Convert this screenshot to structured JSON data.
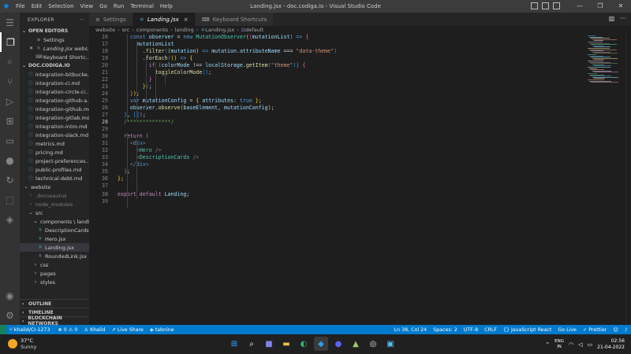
{
  "window": {
    "title": "Landing.jsx - doc.codiga.io - Visual Studio Code",
    "menu": [
      "File",
      "Edit",
      "Selection",
      "View",
      "Go",
      "Run",
      "Terminal",
      "Help"
    ]
  },
  "sidebar": {
    "header": "EXPLORER",
    "open_editors_label": "OPEN EDITORS",
    "open_editors": [
      {
        "name": "Settings",
        "icon": "gear-icon"
      },
      {
        "name": "Landing.jsx  webs...",
        "icon": "react-icon",
        "active": true
      },
      {
        "name": "Keyboard Shortc...",
        "icon": "keyboard-icon"
      }
    ],
    "folder_label": "DOC.CODIGA.IO",
    "tree": [
      {
        "name": "integration-bitbucke...",
        "type": "md",
        "depth": 1
      },
      {
        "name": "integration-ci.md",
        "type": "md",
        "depth": 1
      },
      {
        "name": "integration-circle-ci...",
        "type": "md",
        "depth": 1
      },
      {
        "name": "integration-github-a...",
        "type": "md",
        "depth": 1
      },
      {
        "name": "integration-github.md",
        "type": "md",
        "depth": 1
      },
      {
        "name": "integration-gitlab.md",
        "type": "md",
        "depth": 1
      },
      {
        "name": "integration-intro.md",
        "type": "md",
        "depth": 1
      },
      {
        "name": "integration-slack.md",
        "type": "md",
        "depth": 1
      },
      {
        "name": "metrics.md",
        "type": "md",
        "depth": 1
      },
      {
        "name": "pricing.md",
        "type": "md",
        "depth": 1
      },
      {
        "name": "project-preferences...",
        "type": "md",
        "depth": 1
      },
      {
        "name": "public-profiles.md",
        "type": "md",
        "depth": 1
      },
      {
        "name": "technical-debt.md",
        "type": "md",
        "depth": 1
      },
      {
        "name": "website",
        "type": "folder-open",
        "depth": 0
      },
      {
        "name": ".docusaurus",
        "type": "folder",
        "depth": 1,
        "dim": true
      },
      {
        "name": "node_modules",
        "type": "folder",
        "depth": 1,
        "dim": true
      },
      {
        "name": "src",
        "type": "folder-open",
        "depth": 1
      },
      {
        "name": "components \\ landi...",
        "type": "folder-open",
        "depth": 2
      },
      {
        "name": "DescriptionCards....",
        "type": "jsx",
        "depth": 3
      },
      {
        "name": "Hero.jsx",
        "type": "jsx",
        "depth": 3
      },
      {
        "name": "Landing.jsx",
        "type": "jsx",
        "depth": 3,
        "selected": true
      },
      {
        "name": "RoundedLink.jsx",
        "type": "jsx",
        "depth": 3
      },
      {
        "name": "css",
        "type": "folder",
        "depth": 2
      },
      {
        "name": "pages",
        "type": "folder",
        "depth": 2
      },
      {
        "name": "styles",
        "type": "folder",
        "depth": 2
      }
    ],
    "bottom_sections": [
      "OUTLINE",
      "TIMELINE",
      "BLOCKCHAIN NETWORKS"
    ]
  },
  "tabs": [
    {
      "label": "Settings",
      "icon": "gear-icon"
    },
    {
      "label": "Landing.jsx",
      "icon": "react-icon",
      "active": true,
      "close": "×"
    },
    {
      "label": "Keyboard Shortcuts",
      "icon": "keyboard-icon"
    }
  ],
  "breadcrumb": [
    "website",
    "src",
    "components",
    "landing",
    "Landing.jsx",
    "default"
  ],
  "editor": {
    "current_line": 28,
    "lines": [
      {
        "n": "16",
        "seg": [
          [
            "pl",
            "    "
          ],
          [
            "kw",
            "const "
          ],
          [
            "vr",
            "observer"
          ],
          [
            "pl",
            " = "
          ],
          [
            "kw",
            "new "
          ],
          [
            "cp",
            "MutationObserver"
          ],
          [
            "br1",
            "("
          ],
          [
            "br2",
            "("
          ],
          [
            "vr",
            "mutationList"
          ],
          [
            "br2",
            ")"
          ],
          [
            "pl",
            " "
          ],
          [
            "kw",
            "=>"
          ],
          [
            "pl",
            " "
          ],
          [
            "br2",
            "{"
          ]
        ]
      },
      {
        "n": "17",
        "seg": [
          [
            "pl",
            "      "
          ],
          [
            "vr",
            "mutationList"
          ]
        ]
      },
      {
        "n": "18",
        "seg": [
          [
            "pl",
            "        ."
          ],
          [
            "fn",
            "filter"
          ],
          [
            "br3",
            "("
          ],
          [
            "br1",
            "("
          ],
          [
            "vr",
            "mutation"
          ],
          [
            "br1",
            ")"
          ],
          [
            "pl",
            " "
          ],
          [
            "kw",
            "=>"
          ],
          [
            "pl",
            " "
          ],
          [
            "vr",
            "mutation"
          ],
          [
            "pl",
            "."
          ],
          [
            "vr",
            "attributeName"
          ],
          [
            "pl",
            " === "
          ],
          [
            "str",
            "\"data-theme\""
          ],
          [
            "br3",
            ")"
          ]
        ]
      },
      {
        "n": "19",
        "seg": [
          [
            "pl",
            "        ."
          ],
          [
            "fn",
            "forEach"
          ],
          [
            "br3",
            "("
          ],
          [
            "br1",
            "("
          ],
          [
            "br1",
            ")"
          ],
          [
            "pl",
            " "
          ],
          [
            "kw",
            "=>"
          ],
          [
            "pl",
            " "
          ],
          [
            "br1",
            "{"
          ]
        ]
      },
      {
        "n": "20",
        "seg": [
          [
            "pl",
            "          "
          ],
          [
            "kc",
            "if "
          ],
          [
            "br2",
            "("
          ],
          [
            "vr",
            "colorMode"
          ],
          [
            "pl",
            " !== "
          ],
          [
            "vr",
            "localStorage"
          ],
          [
            "pl",
            "."
          ],
          [
            "fn",
            "getItem"
          ],
          [
            "br3",
            "("
          ],
          [
            "str",
            "\"theme\""
          ],
          [
            "br3",
            ")"
          ],
          [
            "br2",
            ")"
          ],
          [
            "pl",
            " "
          ],
          [
            "br2",
            "{"
          ]
        ]
      },
      {
        "n": "21",
        "seg": [
          [
            "pl",
            "            "
          ],
          [
            "fn",
            "toggleColorMode"
          ],
          [
            "br3",
            "("
          ],
          [
            "br3",
            ")"
          ],
          [
            "pl",
            ";"
          ]
        ]
      },
      {
        "n": "22",
        "seg": [
          [
            "pl",
            "          "
          ],
          [
            "br2",
            "}"
          ]
        ]
      },
      {
        "n": "23",
        "seg": [
          [
            "pl",
            "        "
          ],
          [
            "br1",
            "}"
          ],
          [
            "br3",
            ")"
          ],
          [
            "pl",
            ";"
          ]
        ]
      },
      {
        "n": "24",
        "seg": [
          [
            "pl",
            "    "
          ],
          [
            "br2",
            "}"
          ],
          [
            "br1",
            ")"
          ],
          [
            "pl",
            ";"
          ]
        ]
      },
      {
        "n": "25",
        "seg": [
          [
            "pl",
            "    "
          ],
          [
            "kw",
            "var "
          ],
          [
            "vr",
            "mutationConfig"
          ],
          [
            "pl",
            " = "
          ],
          [
            "br1",
            "{"
          ],
          [
            "pl",
            " "
          ],
          [
            "vr",
            "attributes"
          ],
          [
            "pl",
            ": "
          ],
          [
            "kw",
            "true"
          ],
          [
            "pl",
            " "
          ],
          [
            "br1",
            "}"
          ],
          [
            "pl",
            ";"
          ]
        ]
      },
      {
        "n": "26",
        "seg": [
          [
            "pl",
            "    "
          ],
          [
            "vr",
            "observer"
          ],
          [
            "pl",
            "."
          ],
          [
            "fn",
            "observe"
          ],
          [
            "br1",
            "("
          ],
          [
            "vr",
            "baseElement"
          ],
          [
            "pl",
            ", "
          ],
          [
            "vr",
            "mutationConfig"
          ],
          [
            "br1",
            ")"
          ],
          [
            "pl",
            ";"
          ]
        ]
      },
      {
        "n": "27",
        "seg": [
          [
            "pl",
            "  "
          ],
          [
            "br3",
            "}"
          ],
          [
            "pl",
            ", "
          ],
          [
            "br3",
            "[]"
          ],
          [
            "br2",
            ")"
          ],
          [
            "pl",
            ";"
          ]
        ]
      },
      {
        "n": "28",
        "seg": [
          [
            "pl",
            "  "
          ],
          [
            "cm",
            "/**************/"
          ]
        ]
      },
      {
        "n": "29",
        "seg": [
          [
            "pl",
            "  "
          ]
        ]
      },
      {
        "n": "30",
        "seg": [
          [
            "pl",
            "  "
          ],
          [
            "kc",
            "return "
          ],
          [
            "br2",
            "("
          ]
        ]
      },
      {
        "n": "31",
        "seg": [
          [
            "pl",
            "    "
          ],
          [
            "tg",
            "<"
          ],
          [
            "tn",
            "div"
          ],
          [
            "tg",
            ">"
          ]
        ]
      },
      {
        "n": "32",
        "seg": [
          [
            "pl",
            "      "
          ],
          [
            "tg",
            "<"
          ],
          [
            "cp",
            "Hero"
          ],
          [
            "pl",
            " "
          ],
          [
            "tg",
            "/>"
          ]
        ]
      },
      {
        "n": "33",
        "seg": [
          [
            "pl",
            "      "
          ],
          [
            "tg",
            "<"
          ],
          [
            "cp",
            "DescriptionCards"
          ],
          [
            "pl",
            " "
          ],
          [
            "tg",
            "/>"
          ]
        ]
      },
      {
        "n": "34",
        "seg": [
          [
            "pl",
            "    "
          ],
          [
            "tg",
            "</"
          ],
          [
            "tn",
            "div"
          ],
          [
            "tg",
            ">"
          ]
        ]
      },
      {
        "n": "35",
        "seg": [
          [
            "pl",
            "  "
          ],
          [
            "br2",
            ")"
          ],
          [
            "pl",
            ";"
          ]
        ]
      },
      {
        "n": "36",
        "seg": [
          [
            "br1",
            "}"
          ],
          [
            "pl",
            ";"
          ]
        ]
      },
      {
        "n": "37",
        "seg": [
          [
            "pl",
            ""
          ]
        ]
      },
      {
        "n": "38",
        "seg": [
          [
            "kc",
            "export "
          ],
          [
            "kc",
            "default "
          ],
          [
            "vr",
            "Landing"
          ],
          [
            "pl",
            ";"
          ]
        ]
      },
      {
        "n": "39",
        "seg": [
          [
            "pl",
            ""
          ]
        ]
      }
    ]
  },
  "statusbar": {
    "left": [
      {
        "text": "khalid/CI-1273",
        "icon": "branch-icon"
      },
      {
        "text": "⊗ 0 ⚠ 0",
        "icon": "sync-icon"
      },
      {
        "text": "Khalid",
        "icon": "person-icon"
      },
      {
        "text": "Live Share",
        "icon": "share-icon"
      },
      {
        "text": "tabnine",
        "icon": "tabnine-icon"
      }
    ],
    "right": [
      {
        "text": "Ln 38, Col 24"
      },
      {
        "text": "Spaces: 2"
      },
      {
        "text": "UTF-8"
      },
      {
        "text": "CRLF"
      },
      {
        "text": "{} JavaScript React"
      },
      {
        "text": "Go Live"
      },
      {
        "text": "✓ Prettier"
      }
    ]
  },
  "taskbar": {
    "weather_temp": "37°C",
    "weather_desc": "Sunny",
    "lang_top": "ENG",
    "lang_bottom": "IN",
    "time": "02:56",
    "date": "21-04-2022"
  }
}
